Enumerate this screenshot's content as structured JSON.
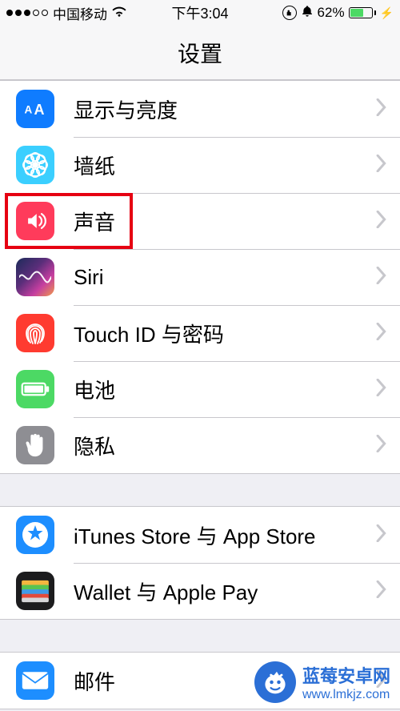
{
  "status": {
    "carrier": "中国移动",
    "time": "下午3:04",
    "battery_pct": "62%"
  },
  "header": {
    "title": "设置"
  },
  "groups": [
    {
      "rows": [
        {
          "id": "display",
          "label": "显示与亮度",
          "highlight": false
        },
        {
          "id": "wallpaper",
          "label": "墙纸",
          "highlight": false
        },
        {
          "id": "sound",
          "label": "声音",
          "highlight": true
        },
        {
          "id": "siri",
          "label": "Siri",
          "highlight": false
        },
        {
          "id": "touchid",
          "label": "Touch ID 与密码",
          "highlight": false
        },
        {
          "id": "battery",
          "label": "电池",
          "highlight": false
        },
        {
          "id": "privacy",
          "label": "隐私",
          "highlight": false
        }
      ]
    },
    {
      "rows": [
        {
          "id": "itunes",
          "label": "iTunes Store 与 App Store",
          "highlight": false
        },
        {
          "id": "wallet",
          "label": "Wallet 与 Apple Pay",
          "highlight": false
        }
      ]
    },
    {
      "rows": [
        {
          "id": "mail",
          "label": "邮件",
          "highlight": false
        }
      ]
    }
  ],
  "watermark": {
    "line1": "蓝莓安卓网",
    "line2": "www.lmkjz.com"
  }
}
